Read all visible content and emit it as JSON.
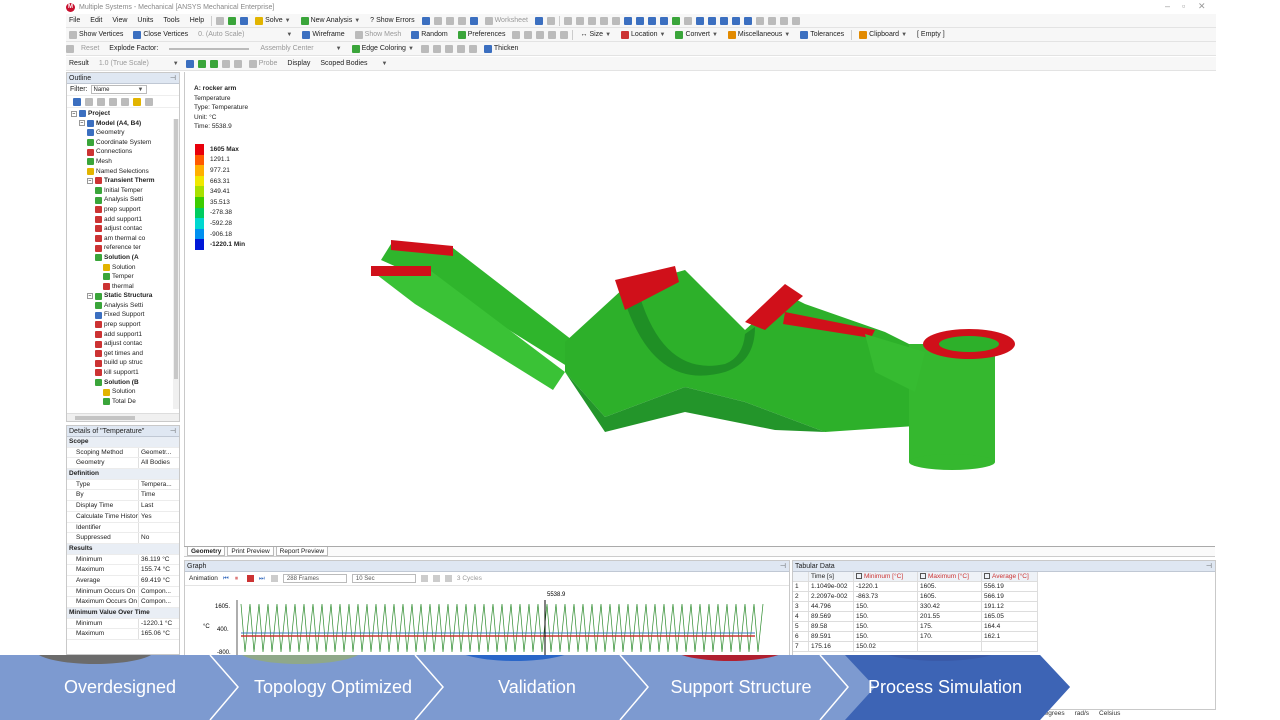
{
  "window": {
    "title": "Multiple Systems - Mechanical [ANSYS Mechanical Enterprise]"
  },
  "toolbar1": {
    "menus": [
      "File",
      "Edit",
      "View",
      "Units",
      "Tools",
      "Help"
    ],
    "solve": "Solve",
    "new_analysis": "New Analysis",
    "show_errors": "Show Errors",
    "worksheet": "Worksheet"
  },
  "toolbar2": {
    "show_vertices": "Show Vertices",
    "close_vertices": "Close Vertices",
    "auto_scale": "0. (Auto Scale)",
    "wireframe": "Wireframe",
    "show_mesh": "Show Mesh",
    "random": "Random",
    "preferences": "Preferences",
    "size": "Size",
    "location": "Location",
    "convert": "Convert",
    "miscellaneous": "Miscellaneous",
    "tolerances": "Tolerances",
    "clipboard": "Clipboard",
    "empty": "[ Empty ]"
  },
  "toolbar3": {
    "reset": "Reset",
    "explode_factor": "Explode Factor:",
    "assembly_center": "Assembly Center",
    "edge_coloring": "Edge Coloring",
    "thicken": "Thicken"
  },
  "toolbar4": {
    "result": "Result",
    "scale": "1.0 (True Scale)",
    "probe": "Probe",
    "display": "Display",
    "scoped_bodies": "Scoped Bodies"
  },
  "outline": {
    "title": "Outline",
    "filter_label": "Filter:",
    "filter_value": "Name",
    "nodes": [
      {
        "depth": 0,
        "label": "Project",
        "bold": true,
        "color": "#3b6fc0"
      },
      {
        "depth": 1,
        "label": "Model (A4, B4)",
        "bold": true,
        "color": "#3b6fc0"
      },
      {
        "depth": 2,
        "label": "Geometry",
        "bold": false,
        "color": "#3b6fc0"
      },
      {
        "depth": 2,
        "label": "Coordinate System",
        "bold": false,
        "color": "#3aa53a"
      },
      {
        "depth": 2,
        "label": "Connections",
        "bold": false,
        "color": "#c33"
      },
      {
        "depth": 2,
        "label": "Mesh",
        "bold": false,
        "color": "#3aa53a"
      },
      {
        "depth": 2,
        "label": "Named Selections",
        "bold": false,
        "color": "#e2b400"
      },
      {
        "depth": 2,
        "label": "Transient Therm",
        "bold": true,
        "color": "#c33"
      },
      {
        "depth": 3,
        "label": "Initial Temper",
        "bold": false,
        "color": "#3aa53a"
      },
      {
        "depth": 3,
        "label": "Analysis Setti",
        "bold": false,
        "color": "#3aa53a"
      },
      {
        "depth": 3,
        "label": "prep support",
        "bold": false,
        "color": "#c33"
      },
      {
        "depth": 3,
        "label": "add support1",
        "bold": false,
        "color": "#c33"
      },
      {
        "depth": 3,
        "label": "adjust contac",
        "bold": false,
        "color": "#c33"
      },
      {
        "depth": 3,
        "label": "am thermal co",
        "bold": false,
        "color": "#c33"
      },
      {
        "depth": 3,
        "label": "reference ter",
        "bold": false,
        "color": "#c33"
      },
      {
        "depth": 3,
        "label": "Solution (A",
        "bold": true,
        "color": "#3aa53a"
      },
      {
        "depth": 4,
        "label": "Solution",
        "bold": false,
        "color": "#e2b400"
      },
      {
        "depth": 4,
        "label": "Temper",
        "bold": false,
        "color": "#3aa53a"
      },
      {
        "depth": 4,
        "label": "thermal",
        "bold": false,
        "color": "#c33"
      },
      {
        "depth": 2,
        "label": "Static Structura",
        "bold": true,
        "color": "#3aa53a"
      },
      {
        "depth": 3,
        "label": "Analysis Setti",
        "bold": false,
        "color": "#3aa53a"
      },
      {
        "depth": 3,
        "label": "Fixed Support",
        "bold": false,
        "color": "#3b6fc0"
      },
      {
        "depth": 3,
        "label": "prep support",
        "bold": false,
        "color": "#c33"
      },
      {
        "depth": 3,
        "label": "add support1",
        "bold": false,
        "color": "#c33"
      },
      {
        "depth": 3,
        "label": "adjust contac",
        "bold": false,
        "color": "#c33"
      },
      {
        "depth": 3,
        "label": "get times and",
        "bold": false,
        "color": "#c33"
      },
      {
        "depth": 3,
        "label": "build up struc",
        "bold": false,
        "color": "#c33"
      },
      {
        "depth": 3,
        "label": "kill support1",
        "bold": false,
        "color": "#c33"
      },
      {
        "depth": 3,
        "label": "Solution (B",
        "bold": true,
        "color": "#3aa53a"
      },
      {
        "depth": 4,
        "label": "Solution",
        "bold": false,
        "color": "#e2b400"
      },
      {
        "depth": 4,
        "label": "Total De",
        "bold": false,
        "color": "#3aa53a"
      }
    ]
  },
  "details": {
    "title": "Details of \"Temperature\"",
    "rows": [
      {
        "section": true,
        "key": "Scope"
      },
      {
        "key": "Scoping Method",
        "value": "Geometr..."
      },
      {
        "key": "Geometry",
        "value": "All Bodies"
      },
      {
        "section": true,
        "key": "Definition"
      },
      {
        "key": "Type",
        "value": "Tempera..."
      },
      {
        "key": "By",
        "value": "Time"
      },
      {
        "key": "Display Time",
        "value": "Last"
      },
      {
        "key": "Calculate Time History",
        "value": "Yes"
      },
      {
        "key": "Identifier",
        "value": ""
      },
      {
        "key": "Suppressed",
        "value": "No"
      },
      {
        "section": true,
        "key": "Results"
      },
      {
        "key": "Minimum",
        "value": "36.119 °C"
      },
      {
        "key": "Maximum",
        "value": "155.74 °C"
      },
      {
        "key": "Average",
        "value": "69.419 °C"
      },
      {
        "key": "Minimum Occurs On",
        "value": "Compon..."
      },
      {
        "key": "Maximum Occurs On",
        "value": "Compon..."
      },
      {
        "section": true,
        "key": "Minimum Value Over Time"
      },
      {
        "key": "Minimum",
        "value": "-1220.1 °C"
      },
      {
        "key": "Maximum",
        "value": "165.06 °C"
      }
    ]
  },
  "legend": {
    "model": "A: rocker arm",
    "type_line": "Temperature",
    "type2": "Type: Temperature",
    "unit": "Unit: °C",
    "time": "Time: 5538.9",
    "entries": [
      {
        "label": "1605 Max",
        "color": "#e8000b",
        "bold": true
      },
      {
        "label": "1291.1",
        "color": "#ff5a00"
      },
      {
        "label": "977.21",
        "color": "#ffb000"
      },
      {
        "label": "663.31",
        "color": "#f0e800"
      },
      {
        "label": "349.41",
        "color": "#a8e000"
      },
      {
        "label": "35.513",
        "color": "#3ccc00"
      },
      {
        "label": "-278.38",
        "color": "#00cc60"
      },
      {
        "label": "-592.28",
        "color": "#00d8d0"
      },
      {
        "label": "-906.18",
        "color": "#0090f0"
      },
      {
        "label": "-1220.1 Min",
        "color": "#0018d8",
        "bold": true
      }
    ]
  },
  "view_tabs": [
    "Geometry",
    "Print Preview",
    "Report Preview"
  ],
  "graph": {
    "title": "Graph",
    "animation": "Animation",
    "frames": "288 Frames",
    "duration": "10 Sec",
    "cycles": "3 Cycles",
    "marker_time": "5538.9",
    "y_ticks": [
      "1605.",
      "400.",
      "-800."
    ],
    "y_unit": "°C"
  },
  "tabular": {
    "title": "Tabular Data",
    "headers": [
      "",
      "Time [s]",
      "Minimum [°C]",
      "Maximum [°C]",
      "Average [°C]"
    ],
    "rows": [
      [
        "1",
        "1.1049e-002",
        "-1220.1",
        "1605.",
        "556.19"
      ],
      [
        "2",
        "2.2097e-002",
        "-863.73",
        "1605.",
        "566.19"
      ],
      [
        "3",
        "44.796",
        "150.",
        "330.42",
        "191.12"
      ],
      [
        "4",
        "89.569",
        "150.",
        "201.55",
        "165.05"
      ],
      [
        "5",
        "89.58",
        "150.",
        "175.",
        "164.4"
      ],
      [
        "6",
        "89.591",
        "150.",
        "170.",
        "162.1"
      ],
      [
        "7",
        "175.16",
        "150.02",
        "",
        ""
      ]
    ]
  },
  "status": {
    "angle": "Degrees",
    "rate": "rad/s",
    "temp": "Celsius"
  },
  "banner": {
    "stages": [
      "Overdesigned",
      "Topology Optimized",
      "Validation",
      "Support Structure",
      "Process Simulation"
    ]
  },
  "colors": {
    "banner": "#7d9ad0",
    "banner_active": "#3d64b5",
    "part_green": "#2fb52c",
    "hot_red": "#d0101a"
  }
}
